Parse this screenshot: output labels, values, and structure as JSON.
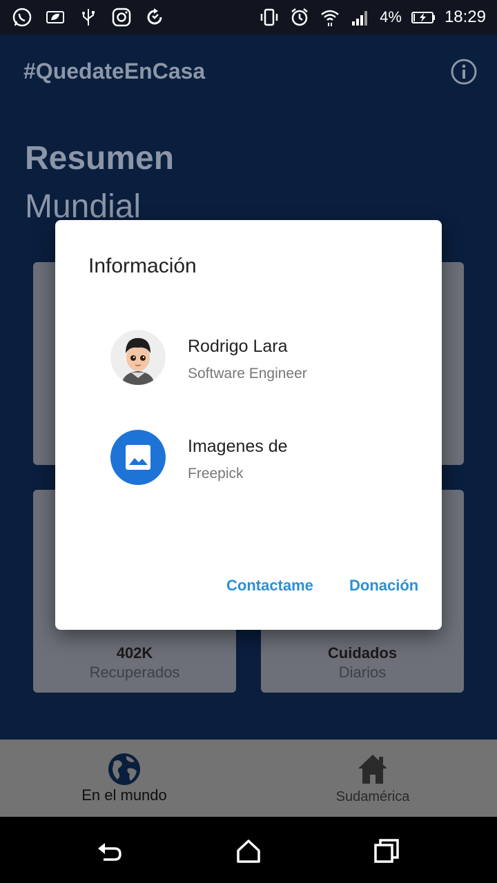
{
  "status_bar": {
    "left_icons": [
      "whatsapp-icon",
      "leaf-icon",
      "usb-icon",
      "instagram-icon",
      "sync-icon"
    ],
    "right_icons": [
      "vibrate-icon",
      "alarm-icon",
      "wifi-icon",
      "signal-icon",
      "battery-icon"
    ],
    "battery": "4%",
    "time": "18:29"
  },
  "app": {
    "title": "#QuedateEnCasa",
    "heading_line1": "Resumen",
    "heading_line2": "Mundial",
    "cards": [
      {
        "value": "",
        "label": ""
      },
      {
        "value": "",
        "label": ""
      },
      {
        "value": "402K",
        "label": "Recuperados"
      },
      {
        "value": "Cuidados",
        "label": "Diarios"
      }
    ]
  },
  "bottom_nav": {
    "items": [
      {
        "label": "En el mundo",
        "icon": "globe-icon"
      },
      {
        "label": "Sudamérica",
        "icon": "home-icon"
      }
    ]
  },
  "dialog": {
    "title": "Información",
    "items": [
      {
        "primary": "Rodrigo Lara",
        "secondary": "Software Engineer",
        "icon": "avatar"
      },
      {
        "primary": "Imagenes de",
        "secondary": "Freepick",
        "icon": "image-icon"
      }
    ],
    "buttons": {
      "contact": "Contactame",
      "donate": "Donación"
    }
  },
  "colors": {
    "background": "#0a1e3d",
    "dialog_accent": "#2b8fd6",
    "image_icon_bg": "#1e73d6"
  }
}
